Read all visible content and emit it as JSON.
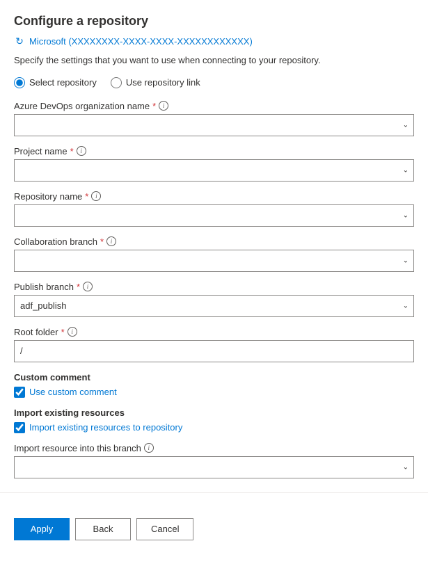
{
  "page": {
    "title": "Configure a repository",
    "org_display": "Microsoft (XXXXXXXX-XXXX-XXXX-XXXXXXXXXXXX)",
    "description": "Specify the settings that you want to use when connecting to your repository."
  },
  "radio_options": [
    {
      "id": "select-repo",
      "label": "Select repository",
      "checked": true
    },
    {
      "id": "use-link",
      "label": "Use repository link",
      "checked": false
    }
  ],
  "fields": {
    "org_name": {
      "label": "Azure DevOps organization name",
      "required": true,
      "value": "",
      "placeholder": ""
    },
    "project_name": {
      "label": "Project name",
      "required": true,
      "value": "",
      "placeholder": ""
    },
    "repository_name": {
      "label": "Repository name",
      "required": true,
      "value": "",
      "placeholder": ""
    },
    "collab_branch": {
      "label": "Collaboration branch",
      "required": true,
      "value": "",
      "placeholder": ""
    },
    "publish_branch": {
      "label": "Publish branch",
      "required": true,
      "value": "adf_publish",
      "placeholder": ""
    },
    "root_folder": {
      "label": "Root folder",
      "required": true,
      "value": "/",
      "placeholder": ""
    }
  },
  "checkboxes": {
    "custom_comment": {
      "title": "Custom comment",
      "label": "Use custom comment",
      "checked": true
    },
    "import_existing": {
      "title": "Import existing resources",
      "label": "Import existing resources to repository",
      "checked": true
    }
  },
  "import_branch": {
    "label": "Import resource into this branch",
    "value": "",
    "placeholder": ""
  },
  "buttons": {
    "apply": "Apply",
    "back": "Back",
    "cancel": "Cancel"
  },
  "icons": {
    "refresh": "↻",
    "info": "i",
    "chevron_down": "⌄"
  }
}
